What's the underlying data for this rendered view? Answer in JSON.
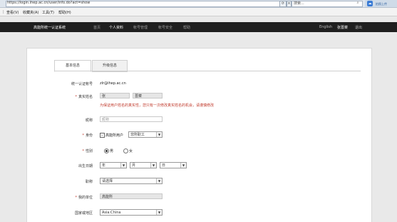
{
  "browser": {
    "url": "https://login.ihep.ac.cn/user/info.do?act=show",
    "search_placeholder": "搜索...",
    "badge_text": "拍照上传",
    "menu": [
      "查看(V)",
      "收藏夹(A)",
      "工具(T)",
      "帮助(H)"
    ]
  },
  "site": {
    "title": "高能所统一认证系统",
    "nav": [
      "首页",
      "个人资料",
      "帐号管理",
      "帐号安全",
      "帮助"
    ],
    "lang": "English",
    "user": "张蔷菜",
    "logout": "退出"
  },
  "tabs": [
    "基本信息",
    "升级信息"
  ],
  "form": {
    "account_label": "统一认证帐号",
    "account_value": "zlr@ihep.ac.cn",
    "name_label": "真实姓名",
    "surname": "张",
    "given_name": "蔷菜",
    "name_warning": "为保证用户姓名的真实性，您只有一次修改真实姓名的机会，请谨慎修改",
    "nickname_label": "昵称",
    "nickname_placeholder": "昵称",
    "identity_label": "身份",
    "identity_checkbox": "高能所用户",
    "identity_select": "非所职工",
    "gender_label": "性别",
    "gender_male": "男",
    "gender_female": "女",
    "birth_label": "出生日期",
    "birth_year": "年",
    "birth_month": "月",
    "birth_day": "日",
    "title_label": "职称",
    "title_select": "请选择",
    "unit_label": "我的单位",
    "unit_value": "高能所",
    "region_label": "国家或地区",
    "region_select": "Asia:China"
  }
}
